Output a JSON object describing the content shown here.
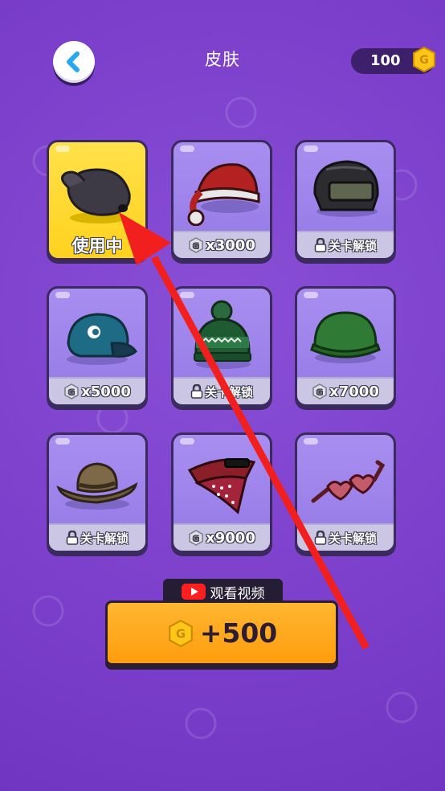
{
  "header": {
    "title": "皮肤",
    "coins": "100"
  },
  "skins": [
    {
      "id": "black-cap",
      "footer": "使用中",
      "status": "in-use"
    },
    {
      "id": "santa-hat",
      "footer": "x3000",
      "status": "price"
    },
    {
      "id": "helmet",
      "footer": "关卡解锁",
      "status": "locked"
    },
    {
      "id": "baseball-cap",
      "footer": "x5000",
      "status": "price"
    },
    {
      "id": "beanie",
      "footer": "关卡解锁",
      "status": "locked"
    },
    {
      "id": "army-helmet",
      "footer": "x7000",
      "status": "price"
    },
    {
      "id": "cowboy-hat",
      "footer": "关卡解锁",
      "status": "locked"
    },
    {
      "id": "bandana",
      "footer": "x9000",
      "status": "price"
    },
    {
      "id": "heart-glasses",
      "footer": "关卡解锁",
      "status": "locked"
    }
  ],
  "reward": {
    "watch_label": "观看视频",
    "amount": "+500"
  },
  "colors": {
    "background": "#7b3fcb",
    "selected": "#ffd21e",
    "button": "#ffa51e"
  }
}
